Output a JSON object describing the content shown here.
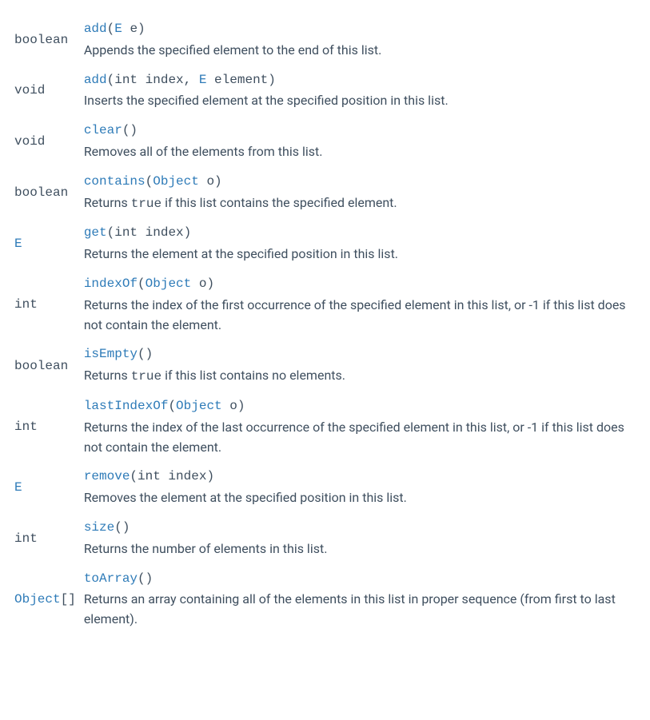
{
  "methods": [
    {
      "return_html": "<span class='return-type-text plain-return'>boolean</span>",
      "signature_html": "<span class='method-name' data-name='method-link-add' data-interactable='true'>add</span><span class='paren-text'>(</span><span class='param-type' data-name='type-link-E' data-interactable='true'>E</span><span class='paren-text'> e)</span>",
      "desc_html": "Appends the specified element to the end of this list."
    },
    {
      "return_html": "<span class='return-type-text plain-return'>void</span>",
      "signature_html": "<span class='method-name' data-name='method-link-add-index' data-interactable='true'>add</span><span class='paren-text'>(int index, </span><span class='param-type' data-name='type-link-E' data-interactable='true'>E</span><span class='paren-text'> element)</span>",
      "desc_html": "Inserts the specified element at the specified position in this list."
    },
    {
      "return_html": "<span class='return-type-text plain-return'>void</span>",
      "signature_html": "<span class='method-name' data-name='method-link-clear' data-interactable='true'>clear</span><span class='paren-text'>()</span>",
      "desc_html": "Removes all of the elements from this list."
    },
    {
      "return_html": "<span class='return-type-text plain-return'>boolean</span>",
      "signature_html": "<span class='method-name' data-name='method-link-contains' data-interactable='true'>contains</span><span class='paren-text'>(</span><span class='param-type' data-name='type-link-Object' data-interactable='true'>Object</span><span class='paren-text'> o)</span>",
      "desc_html": "Returns <span class='inline-code'>true</span> if this list contains the specified element."
    },
    {
      "return_html": "<span class='type-link' data-name='type-link-E' data-interactable='true'>E</span>",
      "signature_html": "<span class='method-name' data-name='method-link-get' data-interactable='true'>get</span><span class='paren-text'>(int index)</span>",
      "desc_html": "Returns the element at the specified position in this list."
    },
    {
      "return_html": "<span class='return-type-text plain-return'>int</span>",
      "signature_html": "<span class='method-name' data-name='method-link-indexOf' data-interactable='true'>indexOf</span><span class='paren-text'>(</span><span class='param-type' data-name='type-link-Object' data-interactable='true'>Object</span><span class='paren-text'> o)</span>",
      "desc_html": "Returns the index of the first occurrence of the specified element in this list, or -1 if this list does not contain the element."
    },
    {
      "return_html": "<span class='return-type-text plain-return'>boolean</span>",
      "signature_html": "<span class='method-name' data-name='method-link-isEmpty' data-interactable='true'>isEmpty</span><span class='paren-text'>()</span>",
      "desc_html": "Returns <span class='inline-code'>true</span> if this list contains no elements."
    },
    {
      "return_html": "<span class='return-type-text plain-return'>int</span>",
      "signature_html": "<span class='method-name' data-name='method-link-lastIndexOf' data-interactable='true'>lastIndexOf</span><span class='paren-text'>(</span><span class='param-type' data-name='type-link-Object' data-interactable='true'>Object</span><span class='paren-text'> o)</span>",
      "desc_html": "Returns the index of the last occurrence of the specified element in this list, or -1 if this list does not contain the element."
    },
    {
      "return_html": "<span class='type-link' data-name='type-link-E' data-interactable='true'>E</span>",
      "signature_html": "<span class='method-name' data-name='method-link-remove' data-interactable='true'>remove</span><span class='paren-text'>(int index)</span>",
      "desc_html": "Removes the element at the specified position in this list."
    },
    {
      "return_html": "<span class='return-type-text plain-return'>int</span>",
      "signature_html": "<span class='method-name' data-name='method-link-size' data-interactable='true'>size</span><span class='paren-text'>()</span>",
      "desc_html": "Returns the number of elements in this list."
    },
    {
      "return_html": "<span class='type-link' data-name='type-link-Object' data-interactable='true'>Object</span><span class='return-type-text plain-return'>[]</span>",
      "signature_html": "<span class='method-name' data-name='method-link-toArray' data-interactable='true'>toArray</span><span class='paren-text'>()</span>",
      "desc_html": "Returns an array containing all of the elements in this list in proper sequence (from first to last element)."
    }
  ]
}
